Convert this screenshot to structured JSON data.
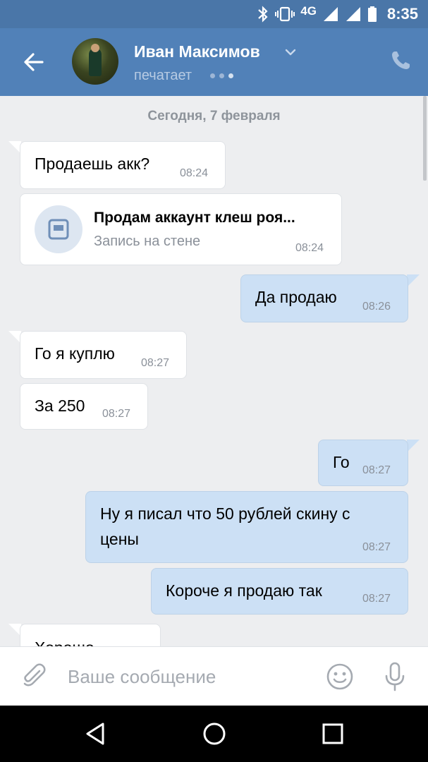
{
  "status_bar": {
    "network": "4G",
    "time": "8:35"
  },
  "header": {
    "contact_name": "Иван Максимов",
    "status": "печатает"
  },
  "chat": {
    "date_separator": "Сегодня, 7 февраля",
    "messages": [
      {
        "direction": "in",
        "text": "Продаешь акк?",
        "time": "08:24"
      },
      {
        "direction": "in",
        "type": "wall_post",
        "title": "Продам аккаунт клеш роя...",
        "subtitle": "Запись на стене",
        "time": "08:24"
      },
      {
        "direction": "out",
        "text": "Да продаю",
        "time": "08:26"
      },
      {
        "direction": "in",
        "text": "Го я куплю",
        "time": "08:27"
      },
      {
        "direction": "in",
        "text": "За 250",
        "time": "08:27"
      },
      {
        "direction": "out",
        "text": "Го",
        "time": "08:27"
      },
      {
        "direction": "out",
        "text_line1": "Ну я писал что 50 рублей скину с",
        "text_line2": "цены",
        "time": "08:27"
      },
      {
        "direction": "out",
        "text": "Короче я продаю так",
        "time": "08:27"
      },
      {
        "direction": "in",
        "text": "Хорошо",
        "partial": true
      }
    ]
  },
  "composer": {
    "placeholder": "Ваше сообщение"
  },
  "icons": {
    "back": "arrow-left",
    "chevron": "chevron-down",
    "call": "phone",
    "attach": "paperclip",
    "emoji": "smiley",
    "voice": "microphone",
    "post": "document"
  },
  "colors": {
    "header": "#5181b8",
    "status_bar": "#4a76a8",
    "background": "#edeef0",
    "incoming_bubble": "#ffffff",
    "outgoing_bubble": "#cce0f5"
  }
}
